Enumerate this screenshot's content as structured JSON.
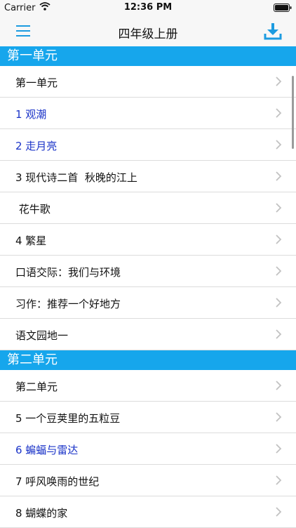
{
  "status_bar": {
    "carrier": "Carrier",
    "time": "12:36 PM"
  },
  "navbar": {
    "title": "四年级上册",
    "menu_icon": "menu-icon",
    "download_icon": "download-icon"
  },
  "accent_color": "#16a6ec",
  "link_color": "#1a33c8",
  "sections": [
    {
      "header": "第一单元",
      "rows": [
        {
          "label": "第一单元",
          "style": "normal"
        },
        {
          "label": "1 观潮",
          "style": "link"
        },
        {
          "label": "2 走月亮",
          "style": "link"
        },
        {
          "label": "3 现代诗二首  秋晚的江上",
          "style": "normal"
        },
        {
          "label": " 花牛歌",
          "style": "normal"
        },
        {
          "label": "4 繁星",
          "style": "normal"
        },
        {
          "label": "口语交际：我们与环境",
          "style": "normal"
        },
        {
          "label": "习作：推荐一个好地方",
          "style": "normal"
        },
        {
          "label": "语文园地一",
          "style": "normal"
        }
      ]
    },
    {
      "header": "第二单元",
      "rows": [
        {
          "label": "第二单元",
          "style": "normal"
        },
        {
          "label": "5 一个豆荚里的五粒豆",
          "style": "normal"
        },
        {
          "label": "6 蝙蝠与雷达",
          "style": "link"
        },
        {
          "label": "7 呼风唤雨的世纪",
          "style": "normal"
        },
        {
          "label": "8 蝴蝶的家",
          "style": "normal"
        }
      ]
    }
  ]
}
